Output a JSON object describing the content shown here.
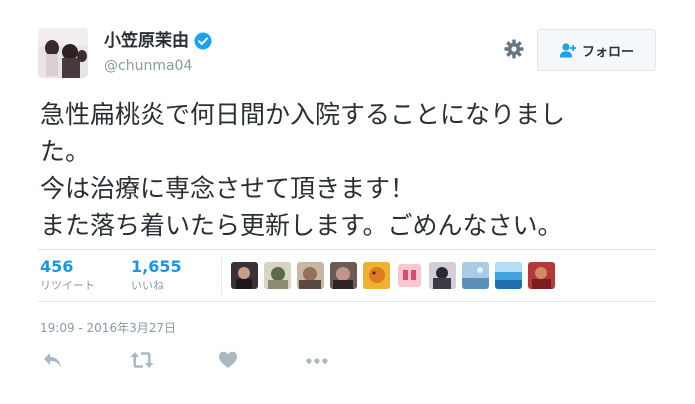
{
  "tweet": {
    "display_name": "小笠原茉由",
    "screen_name": "@chunma04",
    "text_lines": [
      "急性扁桃炎で何日間か入院することになりまし",
      "た。",
      "今は治療に専念させて頂きます！",
      "また落ち着いたら更新します。ごめんなさい。"
    ],
    "timestamp": "19:09 - 2016年3月27日"
  },
  "header": {
    "follow_label": "フォロー"
  },
  "stats": {
    "retweets": "456",
    "retweets_label": "リツイート",
    "likes": "1,655",
    "likes_label": "いいね"
  },
  "colors": {
    "accent": "#1b95e0",
    "muted": "#8899a6",
    "text": "#292f33",
    "border": "#e1e8ed"
  },
  "icons": {
    "verified": "verified-badge-icon",
    "settings": "gear-icon",
    "follow": "follow-person-plus-icon",
    "reply": "reply-icon",
    "retweet": "retweet-icon",
    "like": "heart-icon",
    "more": "more-dots-icon"
  }
}
